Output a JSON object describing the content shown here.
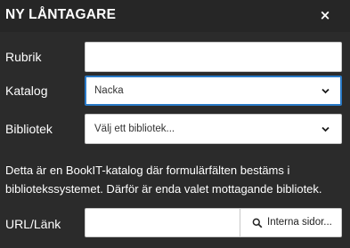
{
  "dialog": {
    "title": "NY LÅNTAGARE",
    "close_icon": "×"
  },
  "form": {
    "rubrik": {
      "label": "Rubrik",
      "value": ""
    },
    "katalog": {
      "label": "Katalog",
      "value": "Nacka"
    },
    "bibliotek": {
      "label": "Bibliotek",
      "value": "Välj ett bibliotek..."
    },
    "description": "Detta är en BookIT-katalog där formulärfälten bestäms i bibliotekssystemet. Därför är enda valet mottagande bibliotek.",
    "url": {
      "label": "URL/Länk",
      "value": "",
      "button_label": "Interna sidor..."
    }
  },
  "colors": {
    "background": "#2b2b2b",
    "header": "#262626",
    "focus_border": "#2a7ac7",
    "input_bg": "#ffffff"
  },
  "icons": {
    "close": "close-icon",
    "dropdown": "chevron-down-icon",
    "search": "search-icon"
  }
}
